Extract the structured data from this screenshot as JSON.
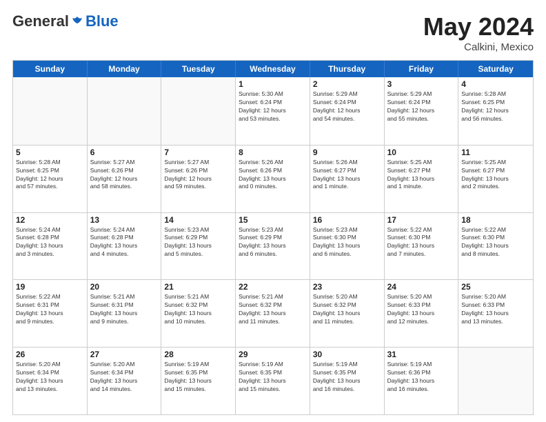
{
  "header": {
    "logo_general": "General",
    "logo_blue": "Blue",
    "month": "May 2024",
    "location": "Calkini, Mexico"
  },
  "weekdays": [
    "Sunday",
    "Monday",
    "Tuesday",
    "Wednesday",
    "Thursday",
    "Friday",
    "Saturday"
  ],
  "rows": [
    [
      {
        "day": "",
        "info": ""
      },
      {
        "day": "",
        "info": ""
      },
      {
        "day": "",
        "info": ""
      },
      {
        "day": "1",
        "info": "Sunrise: 5:30 AM\nSunset: 6:24 PM\nDaylight: 12 hours\nand 53 minutes."
      },
      {
        "day": "2",
        "info": "Sunrise: 5:29 AM\nSunset: 6:24 PM\nDaylight: 12 hours\nand 54 minutes."
      },
      {
        "day": "3",
        "info": "Sunrise: 5:29 AM\nSunset: 6:24 PM\nDaylight: 12 hours\nand 55 minutes."
      },
      {
        "day": "4",
        "info": "Sunrise: 5:28 AM\nSunset: 6:25 PM\nDaylight: 12 hours\nand 56 minutes."
      }
    ],
    [
      {
        "day": "5",
        "info": "Sunrise: 5:28 AM\nSunset: 6:25 PM\nDaylight: 12 hours\nand 57 minutes."
      },
      {
        "day": "6",
        "info": "Sunrise: 5:27 AM\nSunset: 6:26 PM\nDaylight: 12 hours\nand 58 minutes."
      },
      {
        "day": "7",
        "info": "Sunrise: 5:27 AM\nSunset: 6:26 PM\nDaylight: 12 hours\nand 59 minutes."
      },
      {
        "day": "8",
        "info": "Sunrise: 5:26 AM\nSunset: 6:26 PM\nDaylight: 13 hours\nand 0 minutes."
      },
      {
        "day": "9",
        "info": "Sunrise: 5:26 AM\nSunset: 6:27 PM\nDaylight: 13 hours\nand 1 minute."
      },
      {
        "day": "10",
        "info": "Sunrise: 5:25 AM\nSunset: 6:27 PM\nDaylight: 13 hours\nand 1 minute."
      },
      {
        "day": "11",
        "info": "Sunrise: 5:25 AM\nSunset: 6:27 PM\nDaylight: 13 hours\nand 2 minutes."
      }
    ],
    [
      {
        "day": "12",
        "info": "Sunrise: 5:24 AM\nSunset: 6:28 PM\nDaylight: 13 hours\nand 3 minutes."
      },
      {
        "day": "13",
        "info": "Sunrise: 5:24 AM\nSunset: 6:28 PM\nDaylight: 13 hours\nand 4 minutes."
      },
      {
        "day": "14",
        "info": "Sunrise: 5:23 AM\nSunset: 6:29 PM\nDaylight: 13 hours\nand 5 minutes."
      },
      {
        "day": "15",
        "info": "Sunrise: 5:23 AM\nSunset: 6:29 PM\nDaylight: 13 hours\nand 6 minutes."
      },
      {
        "day": "16",
        "info": "Sunrise: 5:23 AM\nSunset: 6:30 PM\nDaylight: 13 hours\nand 6 minutes."
      },
      {
        "day": "17",
        "info": "Sunrise: 5:22 AM\nSunset: 6:30 PM\nDaylight: 13 hours\nand 7 minutes."
      },
      {
        "day": "18",
        "info": "Sunrise: 5:22 AM\nSunset: 6:30 PM\nDaylight: 13 hours\nand 8 minutes."
      }
    ],
    [
      {
        "day": "19",
        "info": "Sunrise: 5:22 AM\nSunset: 6:31 PM\nDaylight: 13 hours\nand 9 minutes."
      },
      {
        "day": "20",
        "info": "Sunrise: 5:21 AM\nSunset: 6:31 PM\nDaylight: 13 hours\nand 9 minutes."
      },
      {
        "day": "21",
        "info": "Sunrise: 5:21 AM\nSunset: 6:32 PM\nDaylight: 13 hours\nand 10 minutes."
      },
      {
        "day": "22",
        "info": "Sunrise: 5:21 AM\nSunset: 6:32 PM\nDaylight: 13 hours\nand 11 minutes."
      },
      {
        "day": "23",
        "info": "Sunrise: 5:20 AM\nSunset: 6:32 PM\nDaylight: 13 hours\nand 11 minutes."
      },
      {
        "day": "24",
        "info": "Sunrise: 5:20 AM\nSunset: 6:33 PM\nDaylight: 13 hours\nand 12 minutes."
      },
      {
        "day": "25",
        "info": "Sunrise: 5:20 AM\nSunset: 6:33 PM\nDaylight: 13 hours\nand 13 minutes."
      }
    ],
    [
      {
        "day": "26",
        "info": "Sunrise: 5:20 AM\nSunset: 6:34 PM\nDaylight: 13 hours\nand 13 minutes."
      },
      {
        "day": "27",
        "info": "Sunrise: 5:20 AM\nSunset: 6:34 PM\nDaylight: 13 hours\nand 14 minutes."
      },
      {
        "day": "28",
        "info": "Sunrise: 5:19 AM\nSunset: 6:35 PM\nDaylight: 13 hours\nand 15 minutes."
      },
      {
        "day": "29",
        "info": "Sunrise: 5:19 AM\nSunset: 6:35 PM\nDaylight: 13 hours\nand 15 minutes."
      },
      {
        "day": "30",
        "info": "Sunrise: 5:19 AM\nSunset: 6:35 PM\nDaylight: 13 hours\nand 16 minutes."
      },
      {
        "day": "31",
        "info": "Sunrise: 5:19 AM\nSunset: 6:36 PM\nDaylight: 13 hours\nand 16 minutes."
      },
      {
        "day": "",
        "info": ""
      }
    ]
  ]
}
